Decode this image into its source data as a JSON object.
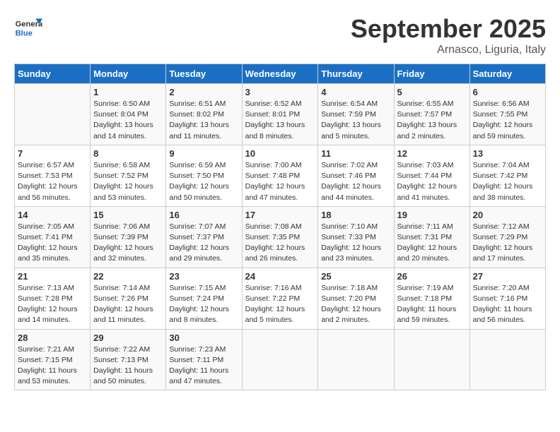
{
  "header": {
    "logo_general": "General",
    "logo_blue": "Blue",
    "month_title": "September 2025",
    "location": "Arnasco, Liguria, Italy"
  },
  "weekdays": [
    "Sunday",
    "Monday",
    "Tuesday",
    "Wednesday",
    "Thursday",
    "Friday",
    "Saturday"
  ],
  "weeks": [
    [
      {
        "day": "",
        "info": ""
      },
      {
        "day": "1",
        "info": "Sunrise: 6:50 AM\nSunset: 8:04 PM\nDaylight: 13 hours\nand 14 minutes."
      },
      {
        "day": "2",
        "info": "Sunrise: 6:51 AM\nSunset: 8:02 PM\nDaylight: 13 hours\nand 11 minutes."
      },
      {
        "day": "3",
        "info": "Sunrise: 6:52 AM\nSunset: 8:01 PM\nDaylight: 13 hours\nand 8 minutes."
      },
      {
        "day": "4",
        "info": "Sunrise: 6:54 AM\nSunset: 7:59 PM\nDaylight: 13 hours\nand 5 minutes."
      },
      {
        "day": "5",
        "info": "Sunrise: 6:55 AM\nSunset: 7:57 PM\nDaylight: 13 hours\nand 2 minutes."
      },
      {
        "day": "6",
        "info": "Sunrise: 6:56 AM\nSunset: 7:55 PM\nDaylight: 12 hours\nand 59 minutes."
      }
    ],
    [
      {
        "day": "7",
        "info": "Sunrise: 6:57 AM\nSunset: 7:53 PM\nDaylight: 12 hours\nand 56 minutes."
      },
      {
        "day": "8",
        "info": "Sunrise: 6:58 AM\nSunset: 7:52 PM\nDaylight: 12 hours\nand 53 minutes."
      },
      {
        "day": "9",
        "info": "Sunrise: 6:59 AM\nSunset: 7:50 PM\nDaylight: 12 hours\nand 50 minutes."
      },
      {
        "day": "10",
        "info": "Sunrise: 7:00 AM\nSunset: 7:48 PM\nDaylight: 12 hours\nand 47 minutes."
      },
      {
        "day": "11",
        "info": "Sunrise: 7:02 AM\nSunset: 7:46 PM\nDaylight: 12 hours\nand 44 minutes."
      },
      {
        "day": "12",
        "info": "Sunrise: 7:03 AM\nSunset: 7:44 PM\nDaylight: 12 hours\nand 41 minutes."
      },
      {
        "day": "13",
        "info": "Sunrise: 7:04 AM\nSunset: 7:42 PM\nDaylight: 12 hours\nand 38 minutes."
      }
    ],
    [
      {
        "day": "14",
        "info": "Sunrise: 7:05 AM\nSunset: 7:41 PM\nDaylight: 12 hours\nand 35 minutes."
      },
      {
        "day": "15",
        "info": "Sunrise: 7:06 AM\nSunset: 7:39 PM\nDaylight: 12 hours\nand 32 minutes."
      },
      {
        "day": "16",
        "info": "Sunrise: 7:07 AM\nSunset: 7:37 PM\nDaylight: 12 hours\nand 29 minutes."
      },
      {
        "day": "17",
        "info": "Sunrise: 7:08 AM\nSunset: 7:35 PM\nDaylight: 12 hours\nand 26 minutes."
      },
      {
        "day": "18",
        "info": "Sunrise: 7:10 AM\nSunset: 7:33 PM\nDaylight: 12 hours\nand 23 minutes."
      },
      {
        "day": "19",
        "info": "Sunrise: 7:11 AM\nSunset: 7:31 PM\nDaylight: 12 hours\nand 20 minutes."
      },
      {
        "day": "20",
        "info": "Sunrise: 7:12 AM\nSunset: 7:29 PM\nDaylight: 12 hours\nand 17 minutes."
      }
    ],
    [
      {
        "day": "21",
        "info": "Sunrise: 7:13 AM\nSunset: 7:28 PM\nDaylight: 12 hours\nand 14 minutes."
      },
      {
        "day": "22",
        "info": "Sunrise: 7:14 AM\nSunset: 7:26 PM\nDaylight: 12 hours\nand 11 minutes."
      },
      {
        "day": "23",
        "info": "Sunrise: 7:15 AM\nSunset: 7:24 PM\nDaylight: 12 hours\nand 8 minutes."
      },
      {
        "day": "24",
        "info": "Sunrise: 7:16 AM\nSunset: 7:22 PM\nDaylight: 12 hours\nand 5 minutes."
      },
      {
        "day": "25",
        "info": "Sunrise: 7:18 AM\nSunset: 7:20 PM\nDaylight: 12 hours\nand 2 minutes."
      },
      {
        "day": "26",
        "info": "Sunrise: 7:19 AM\nSunset: 7:18 PM\nDaylight: 11 hours\nand 59 minutes."
      },
      {
        "day": "27",
        "info": "Sunrise: 7:20 AM\nSunset: 7:16 PM\nDaylight: 11 hours\nand 56 minutes."
      }
    ],
    [
      {
        "day": "28",
        "info": "Sunrise: 7:21 AM\nSunset: 7:15 PM\nDaylight: 11 hours\nand 53 minutes."
      },
      {
        "day": "29",
        "info": "Sunrise: 7:22 AM\nSunset: 7:13 PM\nDaylight: 11 hours\nand 50 minutes."
      },
      {
        "day": "30",
        "info": "Sunrise: 7:23 AM\nSunset: 7:11 PM\nDaylight: 11 hours\nand 47 minutes."
      },
      {
        "day": "",
        "info": ""
      },
      {
        "day": "",
        "info": ""
      },
      {
        "day": "",
        "info": ""
      },
      {
        "day": "",
        "info": ""
      }
    ]
  ]
}
